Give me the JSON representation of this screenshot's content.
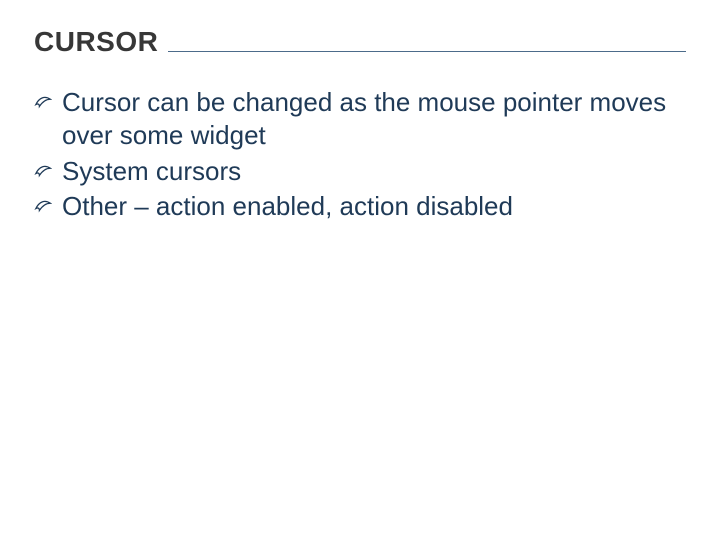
{
  "title": "CURSOR",
  "bullets": [
    "Cursor can be changed as the mouse pointer moves over some widget",
    "System cursors",
    "Other – action enabled, action disabled"
  ]
}
